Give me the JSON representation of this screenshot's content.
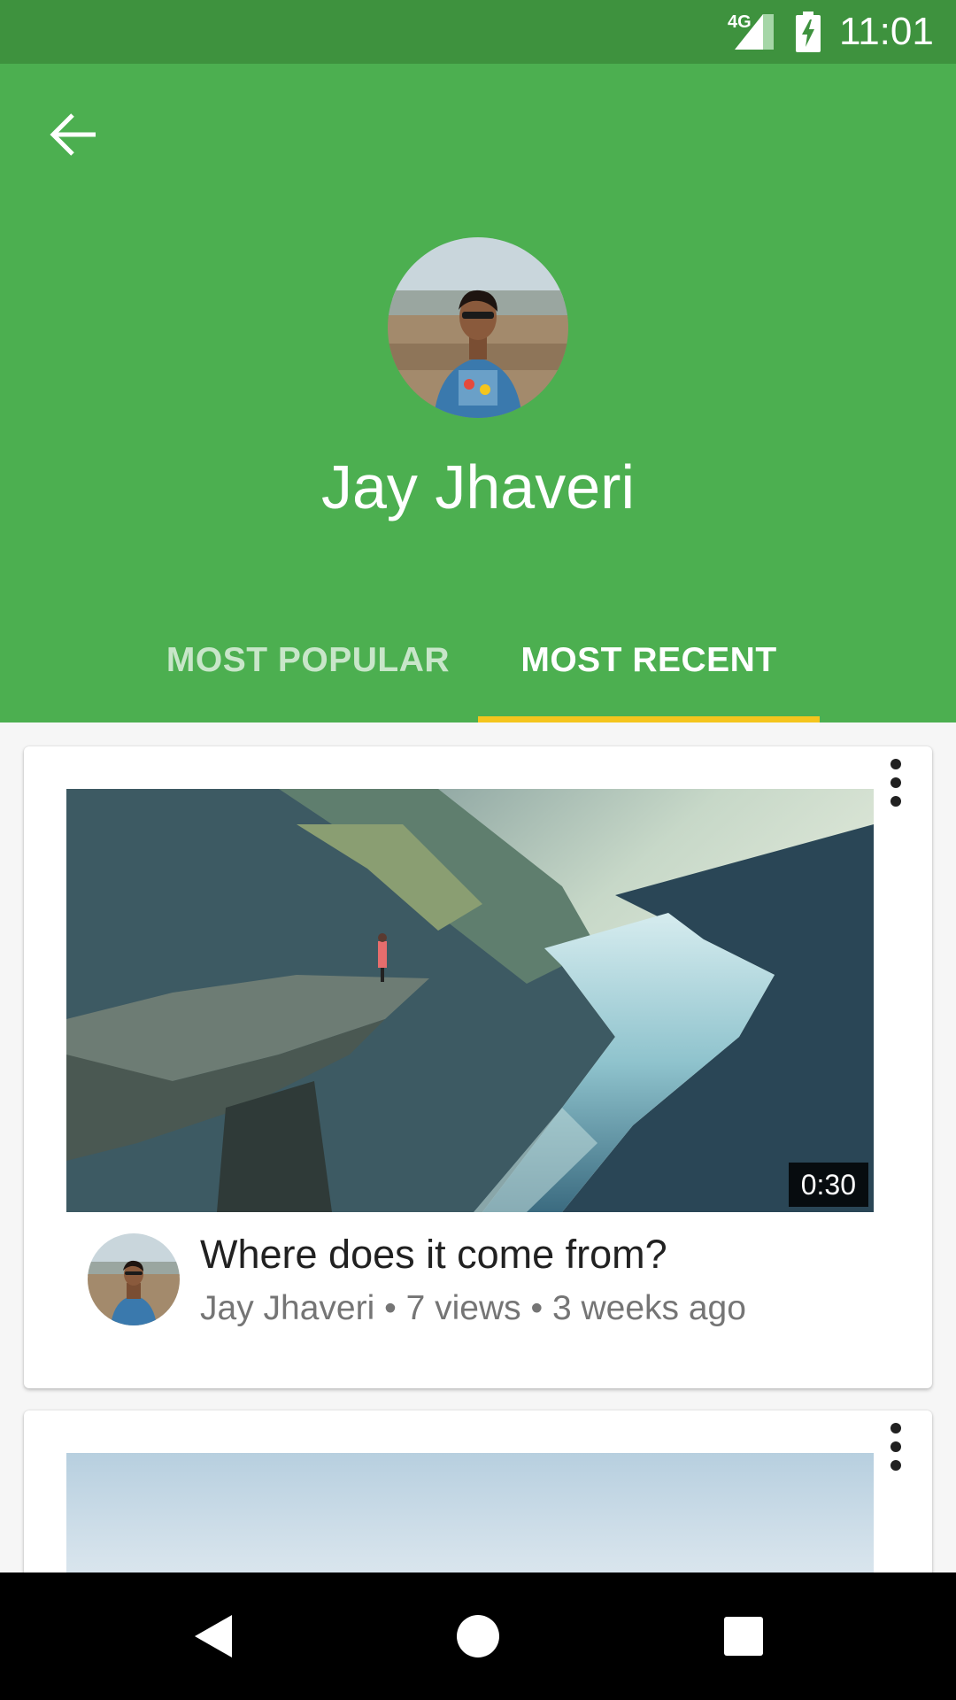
{
  "status_bar": {
    "network": "4G",
    "time": "11:01",
    "icons": [
      "signal-icon",
      "battery-charging-icon"
    ]
  },
  "profile": {
    "name": "Jay Jhaveri"
  },
  "tabs": [
    {
      "label": "MOST POPULAR",
      "selected": false
    },
    {
      "label": "MOST RECENT",
      "selected": true
    }
  ],
  "videos": [
    {
      "title": "Where does it come from?",
      "meta": "Jay Jhaveri • 7 views • 3 weeks ago",
      "duration": "0:30"
    }
  ],
  "colors": {
    "header": "#4caf50",
    "status_bar": "#3e923e",
    "tab_indicator": "#f4c51d",
    "background": "#f6f6f6"
  },
  "nav": {
    "icons": [
      "back-icon",
      "home-icon",
      "recents-icon"
    ]
  }
}
